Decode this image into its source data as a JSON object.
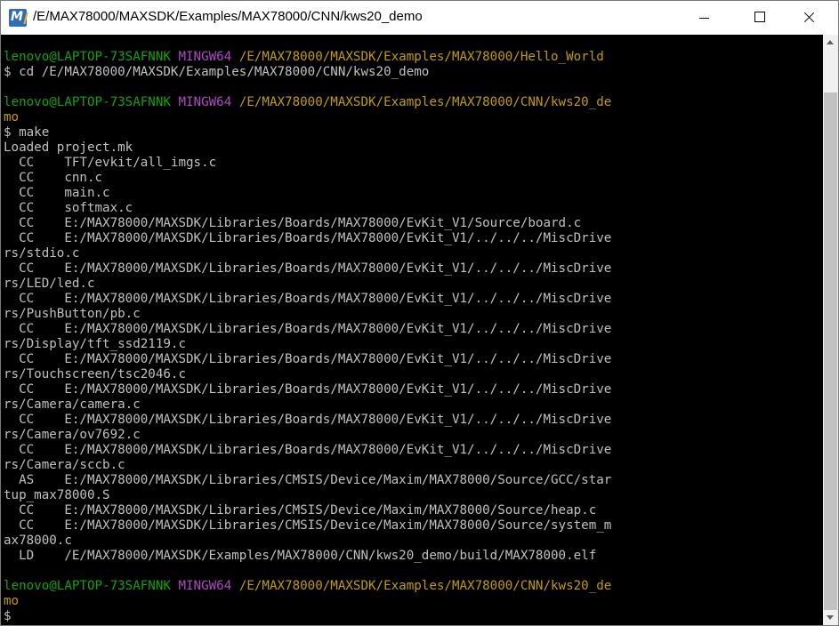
{
  "window": {
    "title": "/E/MAX78000/MAXSDK/Examples/MAX78000/CNN/kws20_demo",
    "icon_letter": "M"
  },
  "colors": {
    "background": "#000000",
    "text": "#c0c0c0",
    "user_host": "#13a10e",
    "shell_name": "#b148c6",
    "path": "#c19c00"
  },
  "terminal": {
    "prompt1": {
      "user": "lenovo@LAPTOP-73SAFNNK",
      "shell": "MINGW64",
      "path": "/E/MAX78000/MAXSDK/Examples/MAX78000/Hello_World"
    },
    "cmd1": "$ cd /E/MAX78000/MAXSDK/Examples/MAX78000/CNN/kws20_demo",
    "prompt2": {
      "user": "lenovo@LAPTOP-73SAFNNK",
      "shell": "MINGW64",
      "path": "/E/MAX78000/MAXSDK/Examples/MAX78000/CNN/kws20_de",
      "path_wrap": "mo"
    },
    "cmd2": "$ make",
    "output": [
      "Loaded project.mk",
      "  CC    TFT/evkit/all_imgs.c",
      "  CC    cnn.c",
      "  CC    main.c",
      "  CC    softmax.c",
      "  CC    E:/MAX78000/MAXSDK/Libraries/Boards/MAX78000/EvKit_V1/Source/board.c",
      "  CC    E:/MAX78000/MAXSDK/Libraries/Boards/MAX78000/EvKit_V1/../../../MiscDrive",
      "rs/stdio.c",
      "  CC    E:/MAX78000/MAXSDK/Libraries/Boards/MAX78000/EvKit_V1/../../../MiscDrive",
      "rs/LED/led.c",
      "  CC    E:/MAX78000/MAXSDK/Libraries/Boards/MAX78000/EvKit_V1/../../../MiscDrive",
      "rs/PushButton/pb.c",
      "  CC    E:/MAX78000/MAXSDK/Libraries/Boards/MAX78000/EvKit_V1/../../../MiscDrive",
      "rs/Display/tft_ssd2119.c",
      "  CC    E:/MAX78000/MAXSDK/Libraries/Boards/MAX78000/EvKit_V1/../../../MiscDrive",
      "rs/Touchscreen/tsc2046.c",
      "  CC    E:/MAX78000/MAXSDK/Libraries/Boards/MAX78000/EvKit_V1/../../../MiscDrive",
      "rs/Camera/camera.c",
      "  CC    E:/MAX78000/MAXSDK/Libraries/Boards/MAX78000/EvKit_V1/../../../MiscDrive",
      "rs/Camera/ov7692.c",
      "  CC    E:/MAX78000/MAXSDK/Libraries/Boards/MAX78000/EvKit_V1/../../../MiscDrive",
      "rs/Camera/sccb.c",
      "  AS    E:/MAX78000/MAXSDK/Libraries/CMSIS/Device/Maxim/MAX78000/Source/GCC/star",
      "tup_max78000.S",
      "  CC    E:/MAX78000/MAXSDK/Libraries/CMSIS/Device/Maxim/MAX78000/Source/heap.c",
      "  CC    E:/MAX78000/MAXSDK/Libraries/CMSIS/Device/Maxim/MAX78000/Source/system_m",
      "ax78000.c",
      "  LD    /E/MAX78000/MAXSDK/Examples/MAX78000/CNN/kws20_demo/build/MAX78000.elf"
    ],
    "prompt3": {
      "user": "lenovo@LAPTOP-73SAFNNK",
      "shell": "MINGW64",
      "path": "/E/MAX78000/MAXSDK/Examples/MAX78000/CNN/kws20_de",
      "path_wrap": "mo"
    },
    "final_prompt": "$"
  }
}
